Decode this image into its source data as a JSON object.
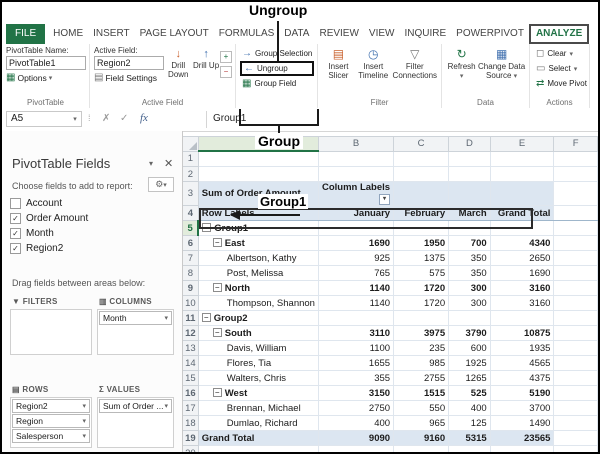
{
  "colors": {
    "accent_green": "#217346",
    "pivot_header_fill": "#dce6f1",
    "annotation": "#000000"
  },
  "annotations": {
    "ungroup_label": "Ungroup",
    "group_label": "Group",
    "group1_label": "Group1"
  },
  "icons": {
    "options": "▦",
    "field_settings": "▤",
    "drill_down": "↓",
    "drill_up": "↑",
    "expand_field": "+",
    "collapse_field": "−",
    "group_selection": "→",
    "ungroup": "←",
    "group_field": "▦",
    "insert_slicer": "▤",
    "insert_timeline": "◷",
    "filter_connections": "▽",
    "refresh": "↻",
    "change_source": "▦",
    "clear": "◻",
    "select": "▭",
    "move": "⇄",
    "cancel": "✗",
    "enter": "✓",
    "splitter": "⁞",
    "pane_options": "▾",
    "close": "✕",
    "gear": "⚙",
    "filters_area": "▼",
    "columns_area": "▥",
    "rows_area": "▤",
    "values_area": "Σ",
    "checkbox_check": "✓",
    "dropdown": "▾",
    "collapse_box": "−"
  },
  "ribbon": {
    "tabs": [
      "FILE",
      "HOME",
      "INSERT",
      "PAGE LAYOUT",
      "FORMULAS",
      "DATA",
      "REVIEW",
      "VIEW",
      "INQUIRE",
      "POWERPIVOT",
      "ANALYZE"
    ],
    "active_tab": "ANALYZE",
    "pivottable": {
      "caption": "PivotTable",
      "name_label": "PivotTable Name:",
      "name_value": "PivotTable1",
      "options_label": "Options"
    },
    "active_field": {
      "caption": "Active Field",
      "label": "Active Field:",
      "value": "Region2",
      "field_settings_label": "Field Settings",
      "drill_down_label": "Drill Down",
      "drill_up_label": "Drill Up"
    },
    "group": {
      "group_selection_label": "Group Selection",
      "ungroup_label": "Ungroup",
      "group_field_label": "Group Field"
    },
    "filter": {
      "caption": "Filter",
      "insert_slicer_label": "Insert Slicer",
      "insert_timeline_label": "Insert Timeline",
      "filter_connections_label": "Filter Connections"
    },
    "data": {
      "caption": "Data",
      "refresh_label": "Refresh",
      "change_source_label": "Change Data Source"
    },
    "actions": {
      "caption": "Actions",
      "clear_label": "Clear",
      "select_label": "Select",
      "move_label": "Move Pivot"
    }
  },
  "formula_bar": {
    "name_box": "A5",
    "fx": "fx",
    "formula": "Group1"
  },
  "fields_panel": {
    "title": "PivotTable Fields",
    "choose_label": "Choose fields to add to report:",
    "fields": [
      {
        "name": "Account",
        "checked": false
      },
      {
        "name": "Order Amount",
        "checked": true
      },
      {
        "name": "Month",
        "checked": true
      },
      {
        "name": "Region2",
        "checked": true
      }
    ],
    "drag_label": "Drag fields between areas below:",
    "areas": {
      "filters_label": "FILTERS",
      "columns_label": "COLUMNS",
      "rows_label": "ROWS",
      "values_label": "VALUES",
      "filters": [],
      "columns": [
        "Month"
      ],
      "rows": [
        "Region2",
        "Region",
        "Salesperson"
      ],
      "values": [
        "Sum of Order ..."
      ]
    }
  },
  "grid": {
    "column_headers": [
      "A",
      "B",
      "C",
      "D",
      "E",
      "F"
    ],
    "selected_cell": "A5",
    "rows": [
      {
        "n": 1,
        "type": "blank"
      },
      {
        "n": 2,
        "type": "blank"
      },
      {
        "n": 3,
        "type": "h1",
        "a": "Sum of Order Amount",
        "b": "Column Labels",
        "filter_dropdown": true
      },
      {
        "n": 4,
        "type": "h2",
        "a": "Row Labels",
        "b": "January",
        "c": "February",
        "d": "March",
        "e": "Grand Total"
      },
      {
        "n": 5,
        "type": "group",
        "a": "Group1",
        "collapse": true,
        "selected": true
      },
      {
        "n": 6,
        "type": "region",
        "a": "East",
        "collapse": true,
        "b": "1690",
        "c": "1950",
        "d": "700",
        "e": "4340"
      },
      {
        "n": 7,
        "type": "person",
        "a": "Albertson, Kathy",
        "b": "925",
        "c": "1375",
        "d": "350",
        "e": "2650"
      },
      {
        "n": 8,
        "type": "person",
        "a": "Post, Melissa",
        "b": "765",
        "c": "575",
        "d": "350",
        "e": "1690"
      },
      {
        "n": 9,
        "type": "region",
        "a": "North",
        "collapse": true,
        "b": "1140",
        "c": "1720",
        "d": "300",
        "e": "3160"
      },
      {
        "n": 10,
        "type": "person",
        "a": "Thompson, Shannon",
        "b": "1140",
        "c": "1720",
        "d": "300",
        "e": "3160"
      },
      {
        "n": 11,
        "type": "group",
        "a": "Group2",
        "collapse": true
      },
      {
        "n": 12,
        "type": "region",
        "a": "South",
        "collapse": true,
        "b": "3110",
        "c": "3975",
        "d": "3790",
        "e": "10875"
      },
      {
        "n": 13,
        "type": "person",
        "a": "Davis, William",
        "b": "1100",
        "c": "235",
        "d": "600",
        "e": "1935"
      },
      {
        "n": 14,
        "type": "person",
        "a": "Flores, Tia",
        "b": "1655",
        "c": "985",
        "d": "1925",
        "e": "4565"
      },
      {
        "n": 15,
        "type": "person",
        "a": "Walters, Chris",
        "b": "355",
        "c": "2755",
        "d": "1265",
        "e": "4375"
      },
      {
        "n": 16,
        "type": "region",
        "a": "West",
        "collapse": true,
        "b": "3150",
        "c": "1515",
        "d": "525",
        "e": "5190"
      },
      {
        "n": 17,
        "type": "person",
        "a": "Brennan, Michael",
        "b": "2750",
        "c": "550",
        "d": "400",
        "e": "3700"
      },
      {
        "n": 18,
        "type": "person",
        "a": "Dumlao, Richard",
        "b": "400",
        "c": "965",
        "d": "125",
        "e": "1490"
      },
      {
        "n": 19,
        "type": "total",
        "a": "Grand Total",
        "b": "9090",
        "c": "9160",
        "d": "5315",
        "e": "23565"
      },
      {
        "n": 20,
        "type": "blank"
      }
    ]
  }
}
